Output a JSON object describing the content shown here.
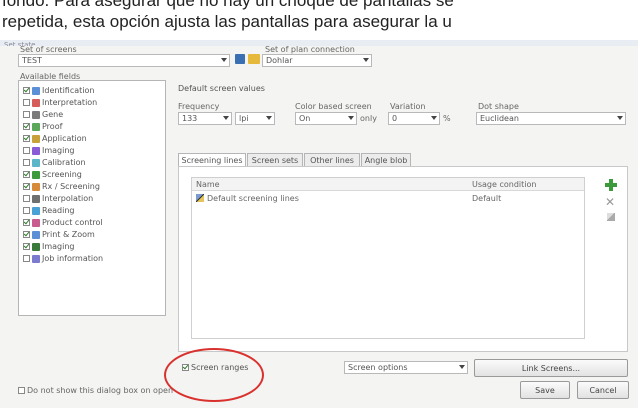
{
  "caption": {
    "line1": "fondo. Para asegurar que no hay un choque de pantallas se",
    "line2": "repetida,  esta opción ajusta las pantallas para asegurar la u"
  },
  "window": {
    "title": "Set state"
  },
  "top": {
    "set_label": "Set of screens",
    "set_value": "TEST",
    "setup_label": "Set of plan connection",
    "setup_value": "Dohlar"
  },
  "tree": {
    "label": "Available fields",
    "items": [
      {
        "label": "Identification",
        "checked": true
      },
      {
        "label": "Interpretation",
        "checked": false
      },
      {
        "label": "Gene",
        "checked": false
      },
      {
        "label": "Proof",
        "checked": true
      },
      {
        "label": "Application",
        "checked": true
      },
      {
        "label": "Imaging",
        "checked": false
      },
      {
        "label": "Calibration",
        "checked": false
      },
      {
        "label": "Screening",
        "checked": true
      },
      {
        "label": "Rx / Screening",
        "checked": true
      },
      {
        "label": "Interpolation",
        "checked": false
      },
      {
        "label": "Reading",
        "checked": false
      },
      {
        "label": "Product control",
        "checked": true
      },
      {
        "label": "Print & Zoom",
        "checked": true
      },
      {
        "label": "Imaging",
        "checked": true
      },
      {
        "label": "Job information",
        "checked": false
      }
    ]
  },
  "defaults": {
    "section_label": "Default screen values",
    "frequency_label": "Frequency",
    "frequency_value": "133",
    "frequency_unit": "lpi",
    "kind_label": "Color based screen",
    "kind_value": "On",
    "kind_unit": "only",
    "angle_label": "Variation",
    "angle_value": "0",
    "angle_unit": "%",
    "dotshape_label": "Dot shape",
    "dotshape_value": "Euclidean"
  },
  "tabs": [
    "Screening lines",
    "Screen sets",
    "Other lines",
    "Angle blob"
  ],
  "table": {
    "col_name": "Name",
    "col_usage": "Usage condition",
    "rows": [
      {
        "name": "Default screening lines",
        "usage": "Default"
      }
    ]
  },
  "bottom": {
    "checkbox_label": "Screen ranges",
    "checkbox_checked": true,
    "select_value": "Screen options",
    "select2_value": "Link Screens...",
    "footer_checkbox_label": "Do not show this dialog box on open",
    "save_label": "Save",
    "cancel_label": "Cancel"
  }
}
